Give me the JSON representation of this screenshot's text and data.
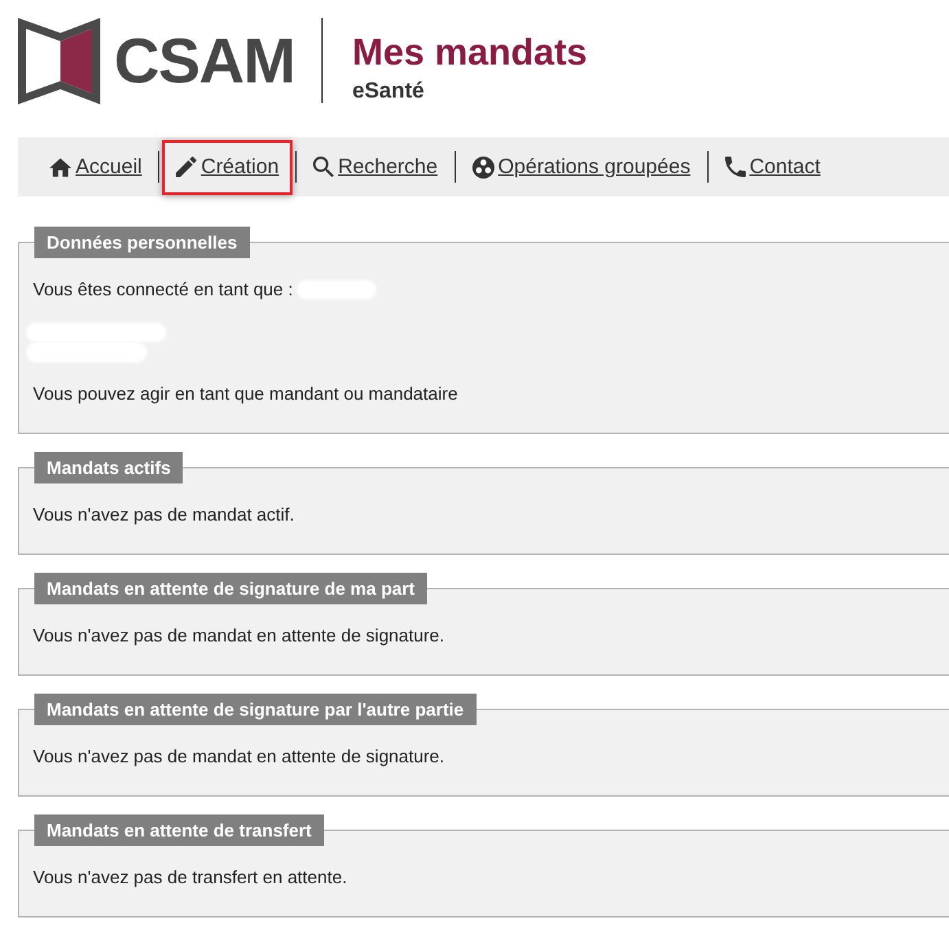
{
  "logo": {
    "text": "CSAM"
  },
  "app": {
    "title": "Mes mandats",
    "subtitle": "eSanté"
  },
  "nav": [
    {
      "label": "Accueil",
      "kind": "home",
      "highlighted": false
    },
    {
      "label": "Création",
      "kind": "edit",
      "highlighted": true
    },
    {
      "label": "Recherche",
      "kind": "search",
      "highlighted": false
    },
    {
      "label": "Opérations groupées",
      "kind": "group",
      "highlighted": false
    },
    {
      "label": "Contact",
      "kind": "contact",
      "highlighted": false
    }
  ],
  "sections": [
    {
      "title": "Données personnelles",
      "blocks": [
        {
          "kind": "identity",
          "text": "Vous êtes connecté en tant que :",
          "redacted": true
        },
        {
          "kind": "address",
          "lines": [
            {
              "redacted": true
            },
            {
              "redacted": true
            }
          ]
        },
        {
          "kind": "text",
          "text": "Vous pouvez agir en tant que mandant ou mandataire"
        }
      ]
    },
    {
      "title": "Mandats actifs",
      "blocks": [
        {
          "kind": "text",
          "text": "Vous n'avez pas de mandat actif."
        }
      ]
    },
    {
      "title": "Mandats en attente de signature de ma part",
      "blocks": [
        {
          "kind": "text",
          "text": "Vous n'avez pas de mandat en attente de signature."
        }
      ]
    },
    {
      "title": "Mandats en attente de signature par l'autre partie",
      "blocks": [
        {
          "kind": "text",
          "text": "Vous n'avez pas de mandat en attente de signature."
        }
      ]
    },
    {
      "title": "Mandats en attente de transfert",
      "blocks": [
        {
          "kind": "text",
          "text": "Vous n'avez pas de transfert en attente."
        }
      ]
    }
  ]
}
